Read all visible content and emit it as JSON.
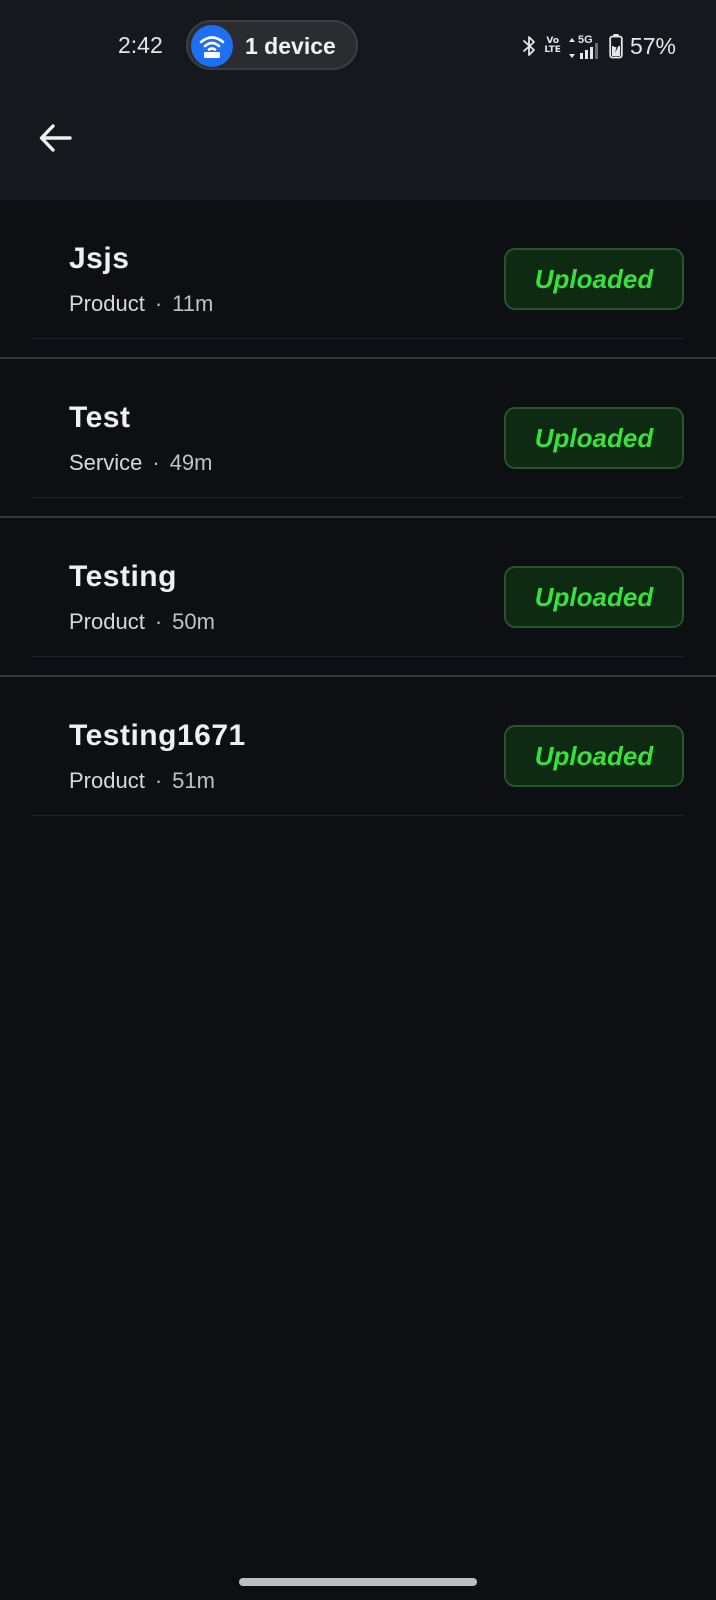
{
  "status_bar": {
    "time": "2:42",
    "hotspot_label": "1 device",
    "volte_top": "Vo",
    "volte_bottom": "LTE",
    "network": "5G",
    "battery": "57%"
  },
  "items": [
    {
      "title": "Jsjs",
      "type": "Product",
      "age": "11m",
      "status": "Uploaded"
    },
    {
      "title": "Test",
      "type": "Service",
      "age": "49m",
      "status": "Uploaded"
    },
    {
      "title": "Testing",
      "type": "Product",
      "age": "50m",
      "status": "Uploaded"
    },
    {
      "title": "Testing1671",
      "type": "Product",
      "age": "51m",
      "status": "Uploaded"
    }
  ],
  "separator": "·",
  "colors": {
    "background": "#0e0f13",
    "topbar": "#15181d",
    "badge_text": "#38e03c",
    "badge_bg": "#0f2a12",
    "hotspot_icon_bg": "#1f6ff2"
  }
}
